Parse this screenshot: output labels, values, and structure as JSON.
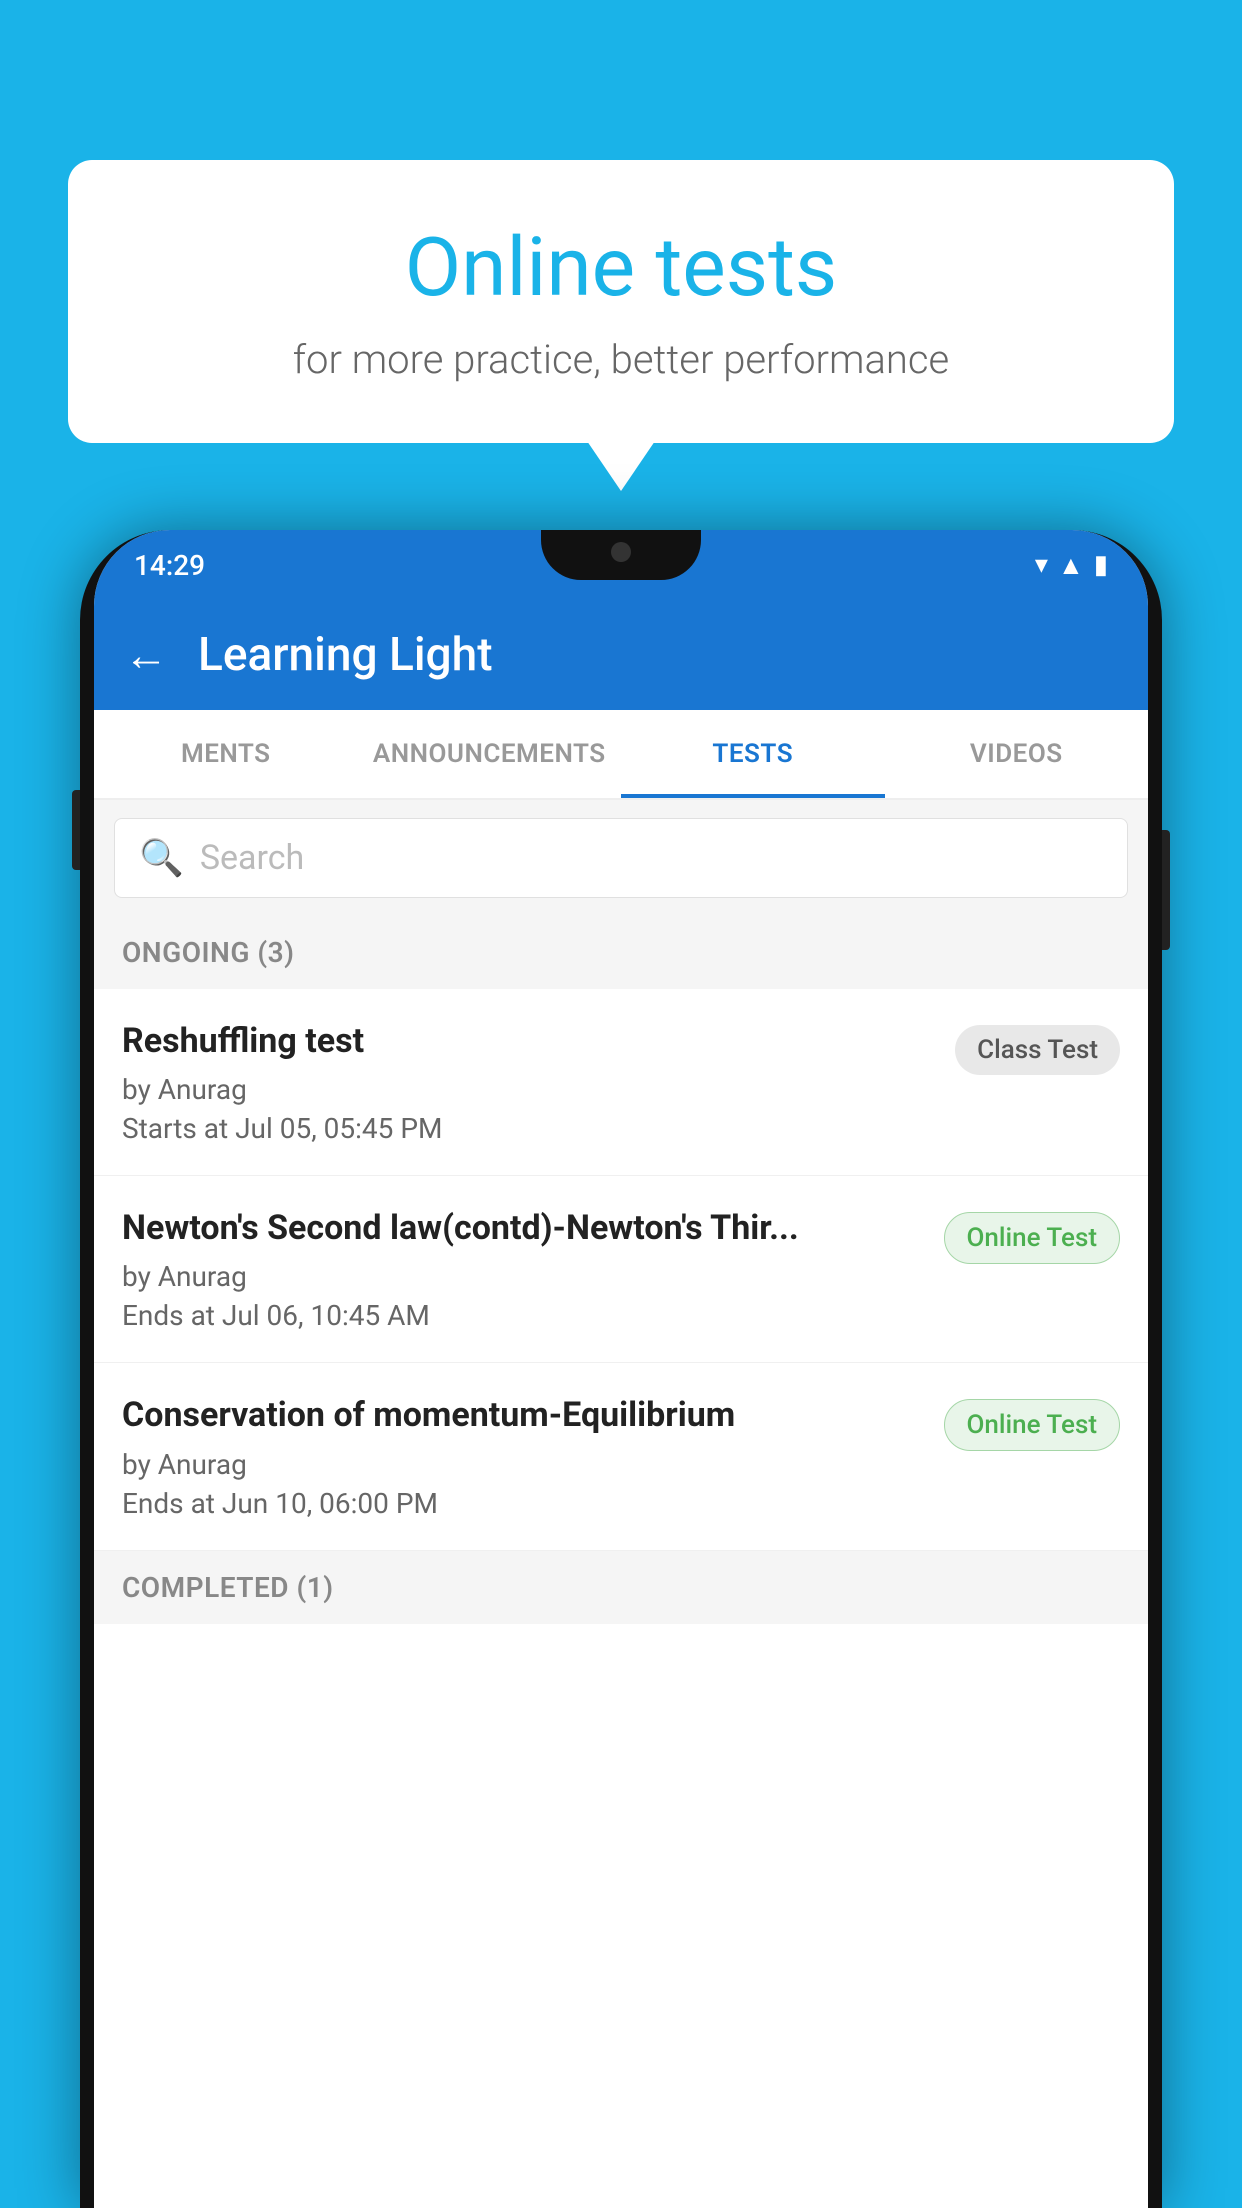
{
  "background_color": "#1ab3e8",
  "bubble": {
    "title": "Online tests",
    "subtitle": "for more practice, better performance"
  },
  "phone": {
    "status_bar": {
      "time": "14:29",
      "wifi_icon": "▼",
      "signal_icon": "▲",
      "battery_icon": "▮"
    },
    "app_bar": {
      "back_label": "←",
      "title": "Learning Light"
    },
    "tabs": [
      {
        "label": "MENTS",
        "active": false
      },
      {
        "label": "ANNOUNCEMENTS",
        "active": false
      },
      {
        "label": "TESTS",
        "active": true
      },
      {
        "label": "VIDEOS",
        "active": false
      }
    ],
    "search": {
      "placeholder": "Search"
    },
    "ongoing_section": {
      "label": "ONGOING (3)"
    },
    "test_items": [
      {
        "name": "Reshuffling test",
        "author": "by Anurag",
        "time_label": "Starts at",
        "time_value": "Jul 05, 05:45 PM",
        "badge": "Class Test",
        "badge_type": "class"
      },
      {
        "name": "Newton's Second law(contd)-Newton's Thir...",
        "author": "by Anurag",
        "time_label": "Ends at",
        "time_value": "Jul 06, 10:45 AM",
        "badge": "Online Test",
        "badge_type": "online"
      },
      {
        "name": "Conservation of momentum-Equilibrium",
        "author": "by Anurag",
        "time_label": "Ends at",
        "time_value": "Jun 10, 06:00 PM",
        "badge": "Online Test",
        "badge_type": "online"
      }
    ],
    "completed_section": {
      "label": "COMPLETED (1)"
    }
  }
}
